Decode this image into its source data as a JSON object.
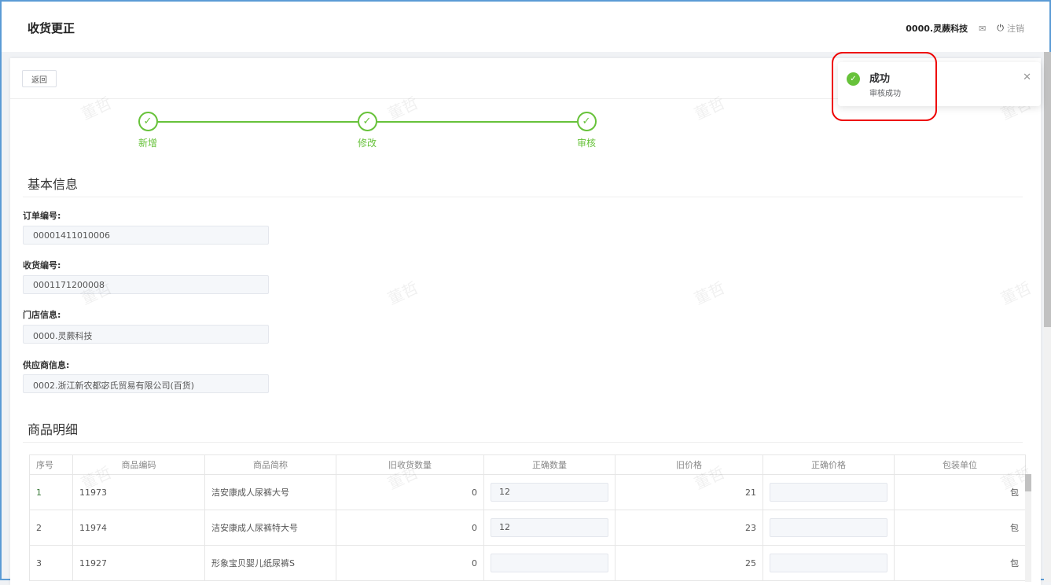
{
  "header": {
    "title": "收货更正",
    "org": "0000.灵蕨科技",
    "logout": "注销"
  },
  "back_label": "返回",
  "steps": [
    "新增",
    "修改",
    "审核"
  ],
  "basic": {
    "title": "基本信息",
    "fields": [
      {
        "label": "订单编号:",
        "value": "00001411010006"
      },
      {
        "label": "收货编号:",
        "value": "0001171200008"
      },
      {
        "label": "门店信息:",
        "value": "0000.灵蕨科技"
      },
      {
        "label": "供应商信息:",
        "value": "0002.浙江新农都宓氏贸易有限公司(百货)"
      }
    ]
  },
  "detail": {
    "title": "商品明细",
    "columns": [
      "序号",
      "商品编码",
      "商品简称",
      "旧收货数量",
      "正确数量",
      "旧价格",
      "正确价格",
      "包装单位"
    ],
    "rows": [
      {
        "no": "1",
        "code": "11973",
        "name": "洁安康成人尿裤大号",
        "old_qty": "0",
        "qty": "12",
        "old_price": "21",
        "price": "",
        "unit": "包"
      },
      {
        "no": "2",
        "code": "11974",
        "name": "洁安康成人尿裤特大号",
        "old_qty": "0",
        "qty": "12",
        "old_price": "23",
        "price": "",
        "unit": "包"
      },
      {
        "no": "3",
        "code": "11927",
        "name": "形象宝贝婴儿纸尿裤S",
        "old_qty": "0",
        "qty": "",
        "old_price": "25",
        "price": "",
        "unit": "包"
      }
    ]
  },
  "toast": {
    "title": "成功",
    "message": "审核成功"
  },
  "watermark": "董哲"
}
